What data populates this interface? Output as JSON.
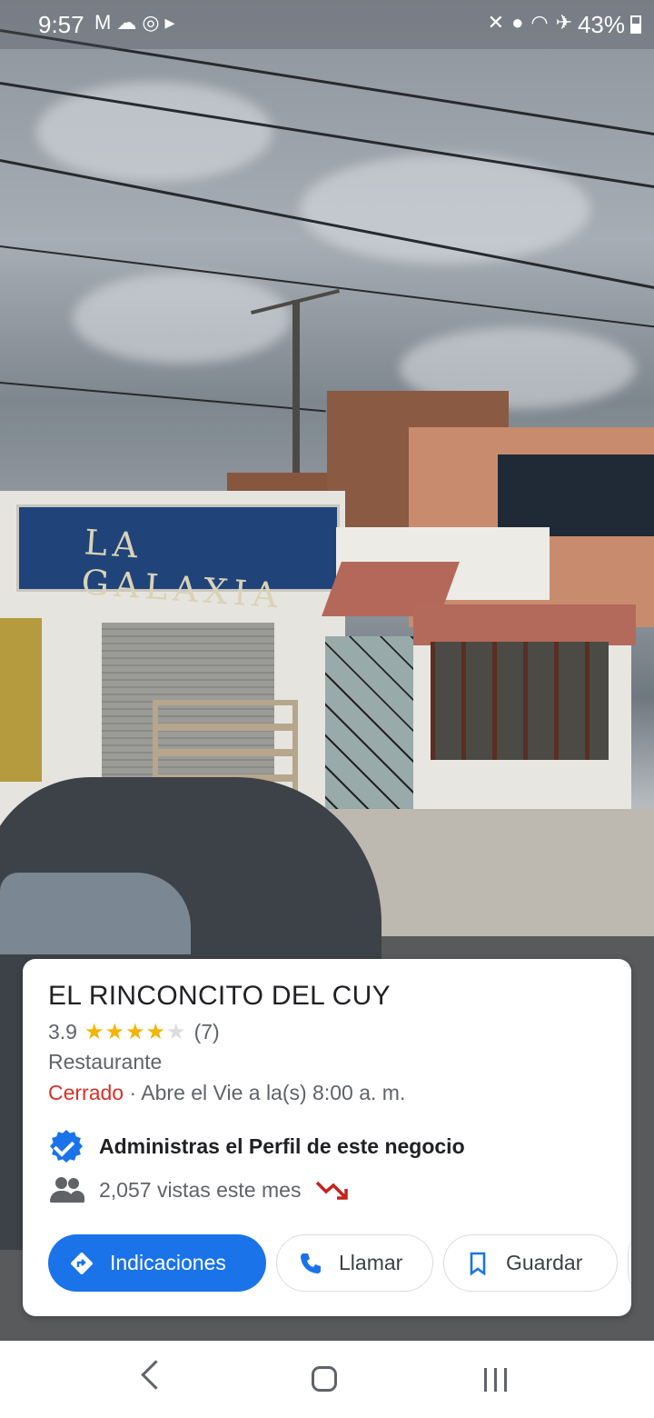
{
  "status_bar": {
    "time": "9:57",
    "left_icons": [
      "gmail-icon",
      "weather-icon",
      "instagram-icon",
      "media-icon"
    ],
    "right_icons": [
      "mute-icon",
      "location-icon",
      "wifi-icon",
      "airplane-icon"
    ],
    "battery": "43%"
  },
  "photo": {
    "sign_text": "LA GALAXIA"
  },
  "place": {
    "name": "EL RINCONCITO DEL CUY",
    "rating": "3.9",
    "rating_stars": 4,
    "reviews": "(7)",
    "category": "Restaurante",
    "status": "Cerrado",
    "hours": " · Abre el Vie a la(s) 8:00 a. m.",
    "owner_text": "Administras el Perfil de este negocio",
    "views_text": "2,057 vistas este mes"
  },
  "actions": {
    "directions": "Indicaciones",
    "call": "Llamar",
    "save": "Guardar"
  },
  "colors": {
    "accent": "#1a73e8",
    "closed": "#d93025",
    "star": "#f4b400",
    "trend_down": "#c5221f"
  }
}
